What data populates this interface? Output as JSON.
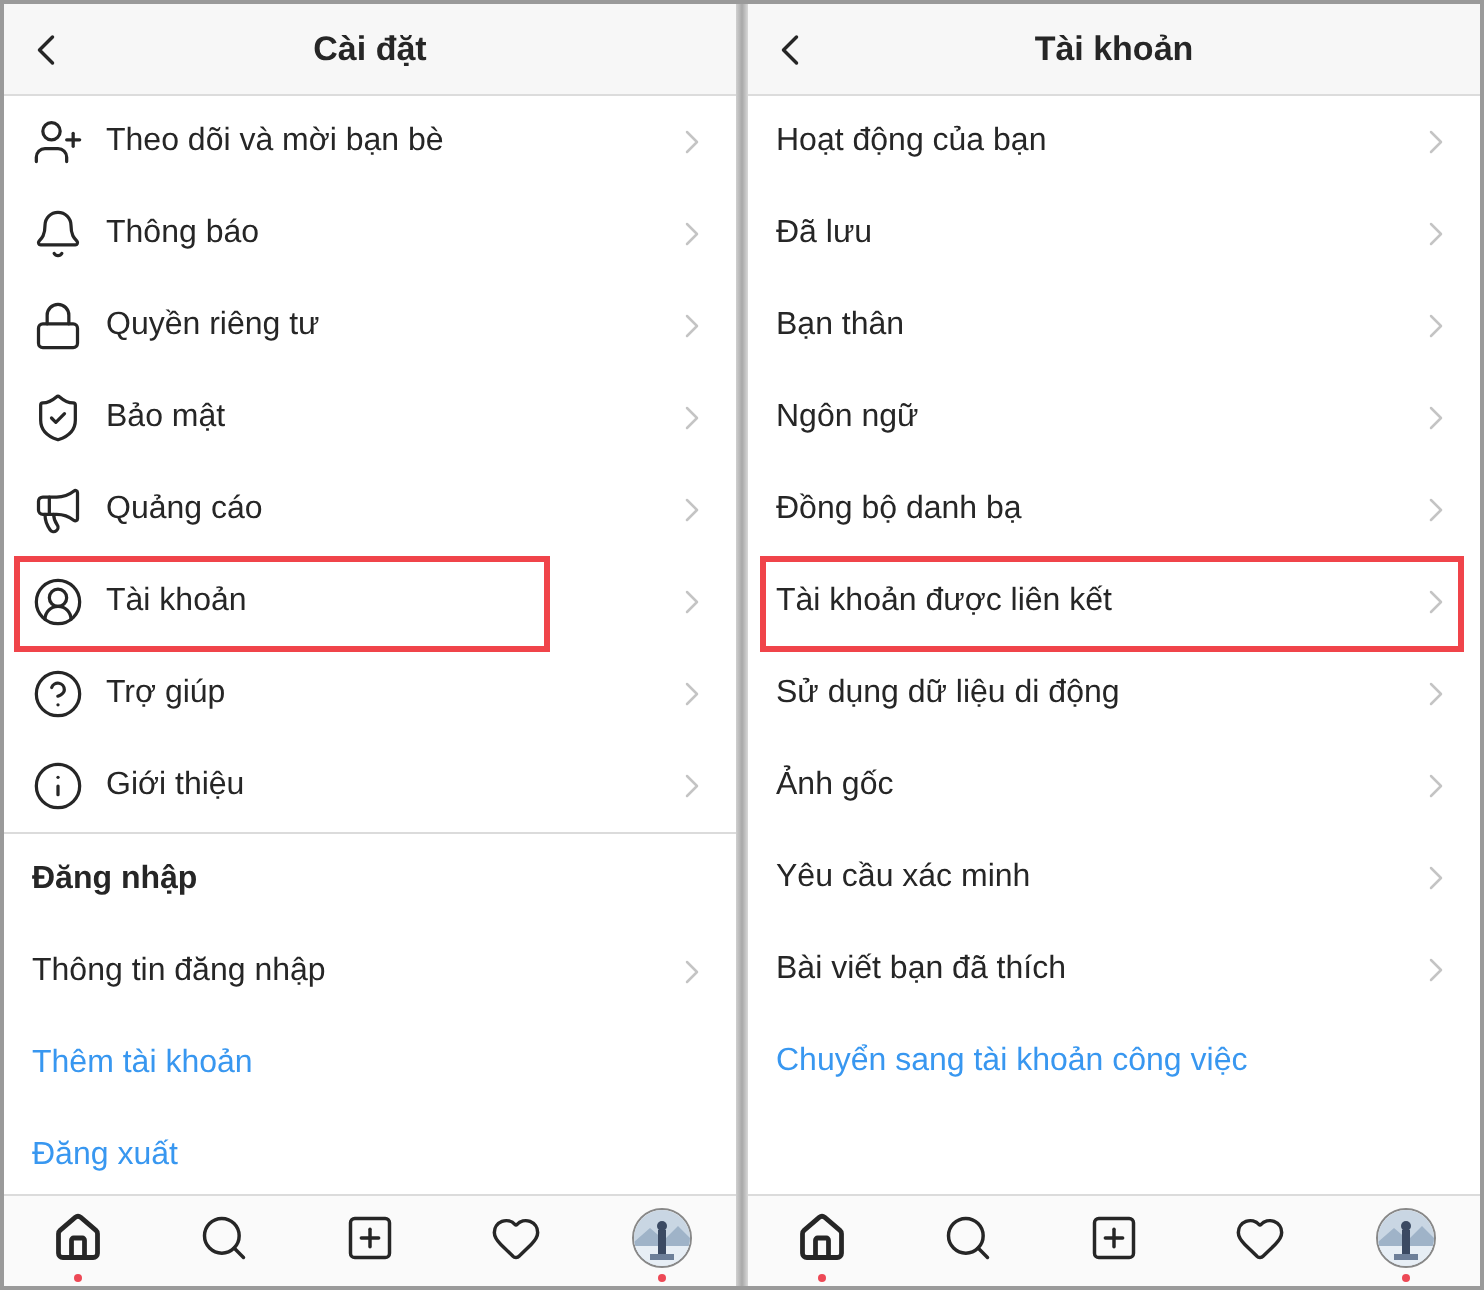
{
  "panels": [
    {
      "title": "Cài đặt",
      "items": [
        {
          "kind": "row",
          "label": "Theo dõi và mời bạn bè",
          "highlighted": false
        },
        {
          "kind": "row",
          "label": "Thông báo",
          "highlighted": false
        },
        {
          "kind": "row",
          "label": "Quyền riêng tư",
          "highlighted": false
        },
        {
          "kind": "row",
          "label": "Bảo mật",
          "highlighted": false
        },
        {
          "kind": "row",
          "label": "Quảng cáo",
          "highlighted": false
        },
        {
          "kind": "row",
          "label": "Tài khoản",
          "highlighted": true
        },
        {
          "kind": "row",
          "label": "Trợ giúp",
          "highlighted": false
        },
        {
          "kind": "row",
          "label": "Giới thiệu",
          "highlighted": false
        },
        {
          "kind": "heading",
          "label": "Đăng nhập"
        },
        {
          "kind": "row",
          "label": "Thông tin đăng nhập",
          "highlighted": false
        },
        {
          "kind": "link",
          "label": "Thêm tài khoản"
        },
        {
          "kind": "link",
          "label": "Đăng xuất"
        }
      ],
      "tabs": [
        {
          "kind": "home",
          "selected": true,
          "dot": true
        },
        {
          "kind": "search",
          "selected": false,
          "dot": false
        },
        {
          "kind": "add",
          "selected": false,
          "dot": false
        },
        {
          "kind": "heart",
          "selected": false,
          "dot": false
        },
        {
          "kind": "profile",
          "selected": false,
          "dot": true
        }
      ]
    },
    {
      "title": "Tài khoản",
      "items": [
        {
          "kind": "row",
          "label": "Hoạt động của bạn",
          "highlighted": false
        },
        {
          "kind": "row",
          "label": "Đã lưu",
          "highlighted": false
        },
        {
          "kind": "row",
          "label": "Bạn thân",
          "highlighted": false
        },
        {
          "kind": "row",
          "label": "Ngôn ngữ",
          "highlighted": false
        },
        {
          "kind": "row",
          "label": "Đồng bộ danh bạ",
          "highlighted": false
        },
        {
          "kind": "row",
          "label": "Tài khoản được liên kết",
          "highlighted": true
        },
        {
          "kind": "row",
          "label": "Sử dụng dữ liệu di động",
          "highlighted": false
        },
        {
          "kind": "row",
          "label": "Ảnh gốc",
          "highlighted": false
        },
        {
          "kind": "row",
          "label": "Yêu cầu xác minh",
          "highlighted": false
        },
        {
          "kind": "row",
          "label": "Bài viết bạn đã thích",
          "highlighted": false
        },
        {
          "kind": "link",
          "label": "Chuyển sang tài khoản công việc"
        }
      ],
      "tabs": [
        {
          "kind": "home",
          "selected": true,
          "dot": true
        },
        {
          "kind": "search",
          "selected": false,
          "dot": false
        },
        {
          "kind": "add",
          "selected": false,
          "dot": false
        },
        {
          "kind": "heart",
          "selected": false,
          "dot": false
        },
        {
          "kind": "profile",
          "selected": false,
          "dot": true
        }
      ]
    }
  ]
}
